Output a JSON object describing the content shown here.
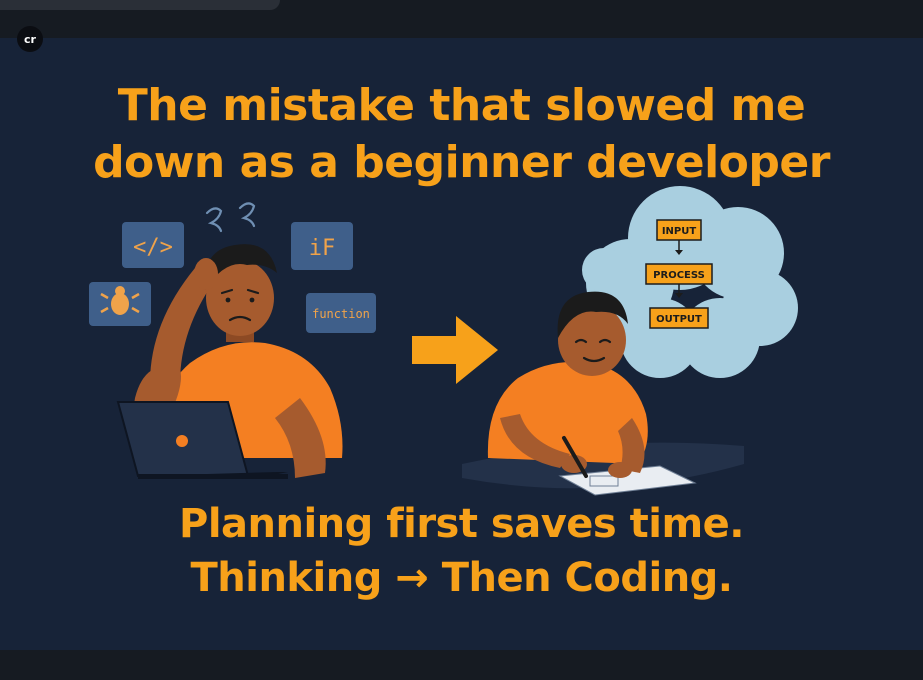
{
  "app": {
    "logo_text": "cr"
  },
  "slide": {
    "headline": "The mistake that slowed me\n down as a beginner developer",
    "caption": "Planning first saves time.\n Thinking → Then Coding.",
    "code_tiles": {
      "tag": "</>",
      "if": "iF",
      "function": "function"
    },
    "flowchart": {
      "input": "INPUT",
      "process": "PROCESS",
      "output": "OUTPUT"
    },
    "colors": {
      "background": "#172338",
      "accent": "#f7a11a",
      "shirt": "#f47f22",
      "skin": "#a65b2e",
      "tile": "#3f5f8a",
      "cloud": "#a9cfe0"
    },
    "icons": [
      "confused-squiggle-icon",
      "bug-icon",
      "laptop-icon",
      "arrow-right-icon",
      "thought-cloud-icon",
      "pencil-icon"
    ]
  }
}
